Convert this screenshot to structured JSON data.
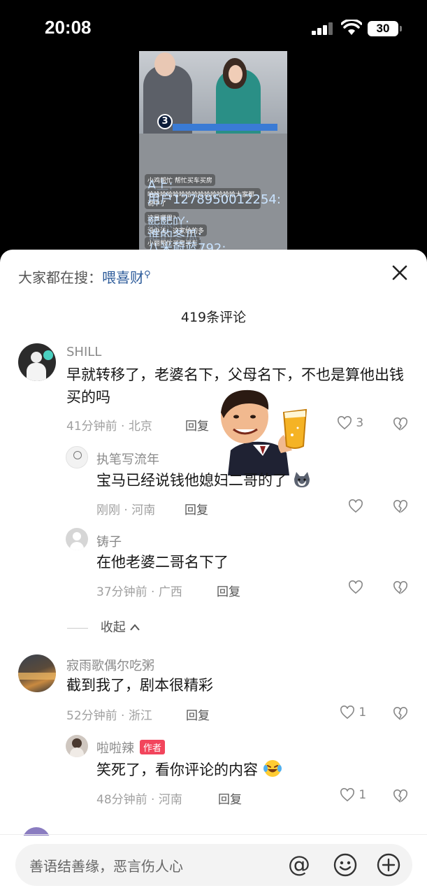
{
  "status_bar": {
    "time": "20:08",
    "battery": "30"
  },
  "video": {
    "badge": "3",
    "danmu": [
      {
        "nick": "A上:",
        "text": " 小鸡帮忙 帮忙买车买房"
      },
      {
        "nick": "用户1278950012254:",
        "text": " 哈哈哈哈哈哈哈哈哈哈哈哈哈哈大家都说中了"
      },
      {
        "nick": "熙熙吖:",
        "text": " 这是哪里?"
      },
      {
        "nick": "谁的冬瓜:",
        "text": " 没办法，这家给的多"
      },
      {
        "nick": "八米蔚蓝792:",
        "text": " 小丽帮忙买房买车"
      }
    ]
  },
  "header": {
    "search_prefix": "大家都在搜：",
    "search_term": "喂喜财",
    "comment_count": "419条评论"
  },
  "comments": [
    {
      "nick": "SHILL",
      "text": "早就转移了，老婆名下，父母名下，不也是算他出钱买的吗",
      "time_loc": "41分钟前 · 北京",
      "reply": "回复",
      "likes": "3"
    },
    {
      "nick": "执笔写流年",
      "text": "宝马已经说钱他媳妇二哥的了",
      "time_loc": "刚刚 · 河南",
      "reply": "回复",
      "likes": ""
    },
    {
      "nick": "铸子",
      "text": "在他老婆二哥名下了",
      "time_loc": "37分钟前 · 广西",
      "reply": "回复",
      "likes": ""
    },
    {
      "nick": "寂雨歌偶尔吃粥",
      "text": "截到我了，剧本很精彩",
      "time_loc": "52分钟前 · 浙江",
      "reply": "回复",
      "likes": "1"
    },
    {
      "nick": "啦啦辣",
      "badge": "作者",
      "text": "笑死了，看你评论的内容",
      "time_loc": "48分钟前 · 河南",
      "reply": "回复",
      "likes": "1"
    }
  ],
  "collapse_label": "收起",
  "input": {
    "placeholder": "善语结善缘，恶言伤人心"
  }
}
